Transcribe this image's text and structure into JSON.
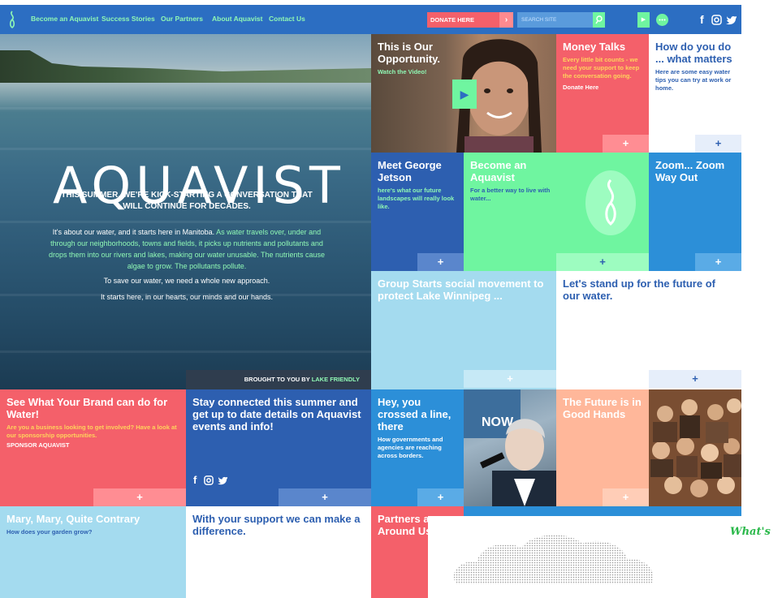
{
  "nav": {
    "links": [
      "Become an Aquavist",
      "Success Stories",
      "Our Partners",
      "About Aquavist",
      "Contact Us"
    ],
    "donate_label": "DONATE HERE",
    "search_placeholder": "SEARCH SITE",
    "social": [
      "f",
      "▣",
      "♥"
    ]
  },
  "hero": {
    "title": "AQUAVIST",
    "subtitle": "THIS SUMMER, WE'RE KICK-STARTING A CONVERSATION THAT WILL CONTINUE FOR DECADES.",
    "body_white": "It's about our water, and it starts here in Manitoba.",
    "body_green": "As water travels over, under and through our neighborhoods, towns and fields, it picks up nutrients and pollutants and drops them into our rivers and lakes, making our water unusable. The nutrients cause algae to grow. The pollutants pollute.",
    "p2": "To save our water, we need a whole new approach.",
    "p3": "It starts here, in our hearts, our minds and our hands.",
    "brought_by": "BROUGHT TO YOU BY",
    "brought_by_partner": "LAKE FRIENDLY"
  },
  "tiles": {
    "opportunity": {
      "title": "This is Our Opportunity.",
      "link": "Watch the Video!"
    },
    "money": {
      "title": "Money Talks",
      "body": "Every little bit counts - we need your support to keep the conversation going.",
      "link": "Donate Here"
    },
    "howdo": {
      "title": "How do you do ... what matters",
      "body": "Here are some easy water tips you can try at work or home."
    },
    "george": {
      "title": "Meet George Jetson",
      "body": "here's what our future landscapes will really look like."
    },
    "become": {
      "title": "Become an Aquavist",
      "body": "For a better way to live with water..."
    },
    "zoom": {
      "title": "Zoom... Zoom Way Out"
    },
    "movement": {
      "title": "Group Starts social movement to protect Lake Winnipeg ..."
    },
    "standup": {
      "title": "Let's stand up for the future of our water."
    },
    "brand": {
      "title": "See What Your Brand can do for Water!",
      "body": "Are you a business looking to get involved? Have a look at our sponsorship opportunities.",
      "link": "SPONSOR AQUAVIST"
    },
    "stay": {
      "title": "Stay connected this summer and get up to date details on Aquavist events and info!"
    },
    "crossed": {
      "title": "Hey, you crossed a line, there",
      "body": "How governments and agencies are reaching across borders.",
      "photo_text": "NOW"
    },
    "future": {
      "title": "The Future is in Good Hands"
    },
    "mary": {
      "title": "Mary, Mary, Quite Contrary",
      "body": "How does your garden grow?"
    },
    "support": {
      "title": "With your support we can make a difference."
    },
    "partners": {
      "title": "Partners a Around Us"
    },
    "whats": "What's"
  },
  "plus": "+",
  "colors": {
    "nav": "#2c6ec2",
    "green": "#6ff5a0",
    "coral": "#f4606a",
    "lightblue": "#a4dbef",
    "blue": "#2f73c9",
    "midblue": "#2c8fd8",
    "navy": "#2d5fb0",
    "peach": "#ffb79a"
  }
}
